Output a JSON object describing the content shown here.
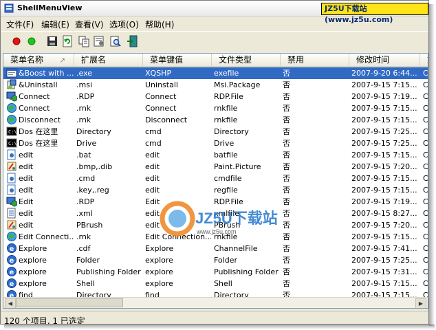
{
  "window": {
    "title": "ShellMenuView",
    "watermark": "JZ5U下载站(www.jz5u.com)"
  },
  "menu": [
    "文件(F)",
    "编辑(E)",
    "查看(V)",
    "选项(O)",
    "帮助(H)"
  ],
  "toolbar": {
    "buttons": [
      "disable-red-icon",
      "enable-green-icon",
      "save-icon",
      "refresh-icon",
      "copy-icon",
      "properties-icon",
      "find-icon",
      "exit-icon"
    ]
  },
  "columns": [
    "菜单名称",
    "扩展名",
    "菜单键值",
    "文件类型",
    "禁用",
    "修改时间",
    "文"
  ],
  "rows": [
    {
      "name": "&Boost with ...",
      "ext": ".exe",
      "key": "XQSHP",
      "type": "exefile",
      "disabled": "否",
      "time": "2007-9-20 6:44...",
      "icon": "exe"
    },
    {
      "name": "&Uninstall",
      "ext": ".msi",
      "key": "Uninstall",
      "type": "Msi.Package",
      "disabled": "否",
      "time": "2007-9-15 7:15...",
      "icon": "installer"
    },
    {
      "name": "Connect",
      "ext": ".RDP",
      "key": "Connect",
      "type": "RDP.File",
      "disabled": "否",
      "time": "2007-9-15 7:19...",
      "icon": "rdp"
    },
    {
      "name": "Connect",
      "ext": ".rnk",
      "key": "Connect",
      "type": "rnkfile",
      "disabled": "否",
      "time": "2007-9-15 7:15...",
      "icon": "globe"
    },
    {
      "name": "Disconnect",
      "ext": ".rnk",
      "key": "Disconnect",
      "type": "rnkfile",
      "disabled": "否",
      "time": "2007-9-15 7:15...",
      "icon": "globe"
    },
    {
      "name": "Dos 在这里",
      "ext": "Directory",
      "key": "cmd",
      "type": "Directory",
      "disabled": "否",
      "time": "2007-9-15 7:25...",
      "icon": "cmd"
    },
    {
      "name": "Dos 在这里",
      "ext": "Drive",
      "key": "cmd",
      "type": "Drive",
      "disabled": "否",
      "time": "2007-9-15 7:25...",
      "icon": "cmd"
    },
    {
      "name": "edit",
      "ext": ".bat",
      "key": "edit",
      "type": "batfile",
      "disabled": "否",
      "time": "2007-9-15 7:15...",
      "icon": "gear"
    },
    {
      "name": "edit",
      "ext": ".bmp,.dib",
      "key": "edit",
      "type": "Paint.Picture",
      "disabled": "否",
      "time": "2007-9-15 7:20...",
      "icon": "paint"
    },
    {
      "name": "edit",
      "ext": ".cmd",
      "key": "edit",
      "type": "cmdfile",
      "disabled": "否",
      "time": "2007-9-15 7:15...",
      "icon": "gear"
    },
    {
      "name": "edit",
      "ext": ".key,.reg",
      "key": "edit",
      "type": "regfile",
      "disabled": "否",
      "time": "2007-9-15 7:15...",
      "icon": "gear"
    },
    {
      "name": "Edit",
      "ext": ".RDP",
      "key": "Edit",
      "type": "RDP.File",
      "disabled": "否",
      "time": "2007-9-15 7:19...",
      "icon": "rdp"
    },
    {
      "name": "edit",
      "ext": ".xml",
      "key": "edit",
      "type": "xmlfile",
      "disabled": "否",
      "time": "2007-9-15 8:27...",
      "icon": "doc"
    },
    {
      "name": "edit",
      "ext": "PBrush",
      "key": "edit",
      "type": "PBrush",
      "disabled": "否",
      "time": "2007-9-15 7:20...",
      "icon": "paint"
    },
    {
      "name": "Edit Connecti...",
      "ext": ".rnk",
      "key": "Edit Connection...",
      "type": "rnkfile",
      "disabled": "否",
      "time": "2007-9-15 7:15...",
      "icon": "globe"
    },
    {
      "name": "Explore",
      "ext": ".cdf",
      "key": "Explore",
      "type": "ChannelFile",
      "disabled": "否",
      "time": "2007-9-15 7:41...",
      "icon": "ie"
    },
    {
      "name": "explore",
      "ext": "Folder",
      "key": "explore",
      "type": "Folder",
      "disabled": "否",
      "time": "2007-9-15 7:25...",
      "icon": "ie"
    },
    {
      "name": "explore",
      "ext": "Publishing Folder",
      "key": "explore",
      "type": "Publishing Folder",
      "disabled": "否",
      "time": "2007-9-15 7:31...",
      "icon": "ie"
    },
    {
      "name": "explore",
      "ext": "Shell",
      "key": "explore",
      "type": "Shell",
      "disabled": "否",
      "time": "2007-9-15 7:15...",
      "icon": "ie"
    },
    {
      "name": "find",
      "ext": "Directory",
      "key": "find",
      "type": "Directory",
      "disabled": "否",
      "time": "2007-9-15 7:15...",
      "icon": "ie"
    }
  ],
  "last_col_glyph": "C",
  "status": "120 个项目, 1 已选定",
  "logo": {
    "brand": "JZ5U下载站",
    "url": "www.jz5u.com"
  }
}
